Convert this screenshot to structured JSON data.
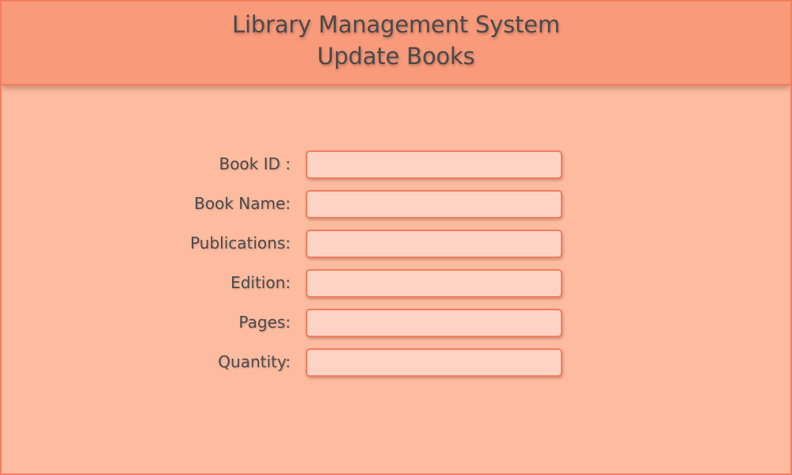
{
  "header": {
    "title": "Library Management System",
    "subtitle": "Update Books"
  },
  "form": {
    "fields": [
      {
        "label": "Book ID :",
        "value": ""
      },
      {
        "label": "Book Name:",
        "value": ""
      },
      {
        "label": "Publications:",
        "value": ""
      },
      {
        "label": "Edition:",
        "value": ""
      },
      {
        "label": "Pages:",
        "value": ""
      },
      {
        "label": "Quantity:",
        "value": ""
      }
    ]
  },
  "colors": {
    "background": "#fdbca0",
    "header": "#f99a7a",
    "border": "#f47e5f",
    "field": "#fed3c6",
    "text": "#4a4a4a"
  }
}
